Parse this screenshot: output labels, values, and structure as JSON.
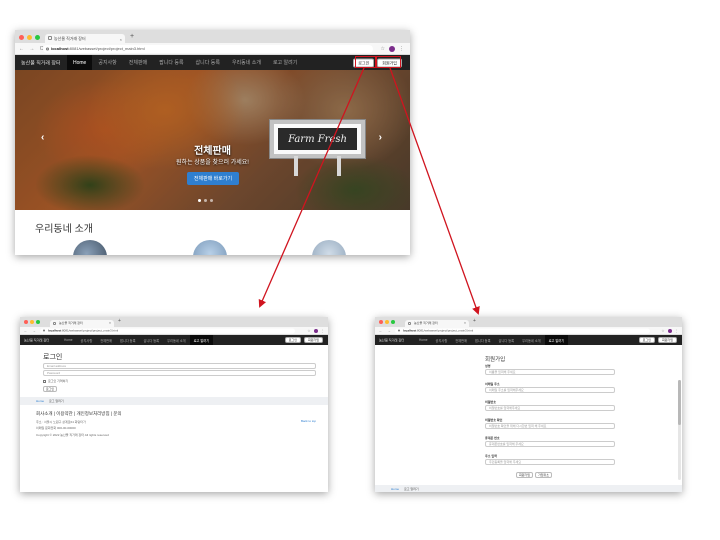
{
  "browser": {
    "tab_title": "농산물 직거래 장터",
    "url_host": "localhost",
    "url_rest_main": ":8081/webasset/project/project_main3.html",
    "url_rest_small": ":8081/webasset/project/project_main3.html"
  },
  "site": {
    "brand": "농산물 직거래 장터",
    "menu": [
      "Home",
      "공지사항",
      "전체판매",
      "팝니다 등록",
      "삽니다 등록",
      "우리동네 소개",
      "로고 알려기"
    ],
    "active_main": "Home",
    "active_small": "로고 알려기",
    "login_label": "로그인",
    "signup_label": "회원가입"
  },
  "hero": {
    "sign_text": "Farm Fresh",
    "title": "전체판매",
    "subtitle": "원하는 상품을 찾으러 가세요!",
    "cta": "전체판매 바로가기",
    "prev": "‹",
    "next": "›"
  },
  "intro": {
    "title": "우리동네 소개"
  },
  "login_page": {
    "title": "로그인",
    "email_placeholder": "Email address",
    "password_placeholder": "Password",
    "remember": "로그인 기억하기",
    "submit": "로그인",
    "crumb_home": "Home",
    "crumb_current": "로그 알려기",
    "footer_links": "회사소개  |  이용약관  |  개인정보처리방침  |  문의",
    "address": "주소 : 서울시 노원구 상계로64 화랑타가",
    "phone": "이메일 문화전화 000-00-00000",
    "copyright": "Copyright © 2022 농산물 직거래 장터 All rights reserved",
    "back_to_top": "Back to top"
  },
  "join_page": {
    "title": "회원가입",
    "fields": [
      {
        "label": "성명",
        "placeholder": "이름을 입력해 주세요"
      },
      {
        "label": "이메일 주소",
        "placeholder": "이메일 주소를 입력해주세요"
      },
      {
        "label": "비밀번호",
        "placeholder": "비밀번호를 입력해주세요"
      },
      {
        "label": "비밀번호 확인",
        "placeholder": "비밀번호 확인을 위해 다시한번 입력 해 주세요"
      },
      {
        "label": "휴대폰 번호",
        "placeholder": "휴대폰번호를 입력해 주세요"
      },
      {
        "label": "주소 입력",
        "placeholder": "주민등록을 입력해 주세요"
      }
    ],
    "submit": "회원가입",
    "cancel": "가입취소",
    "crumb_home": "Home",
    "crumb_current": "로고 알려기"
  },
  "colors": {
    "annotation": "#d0141f",
    "navbar": "#222222",
    "cta": "#2f7fd0"
  }
}
